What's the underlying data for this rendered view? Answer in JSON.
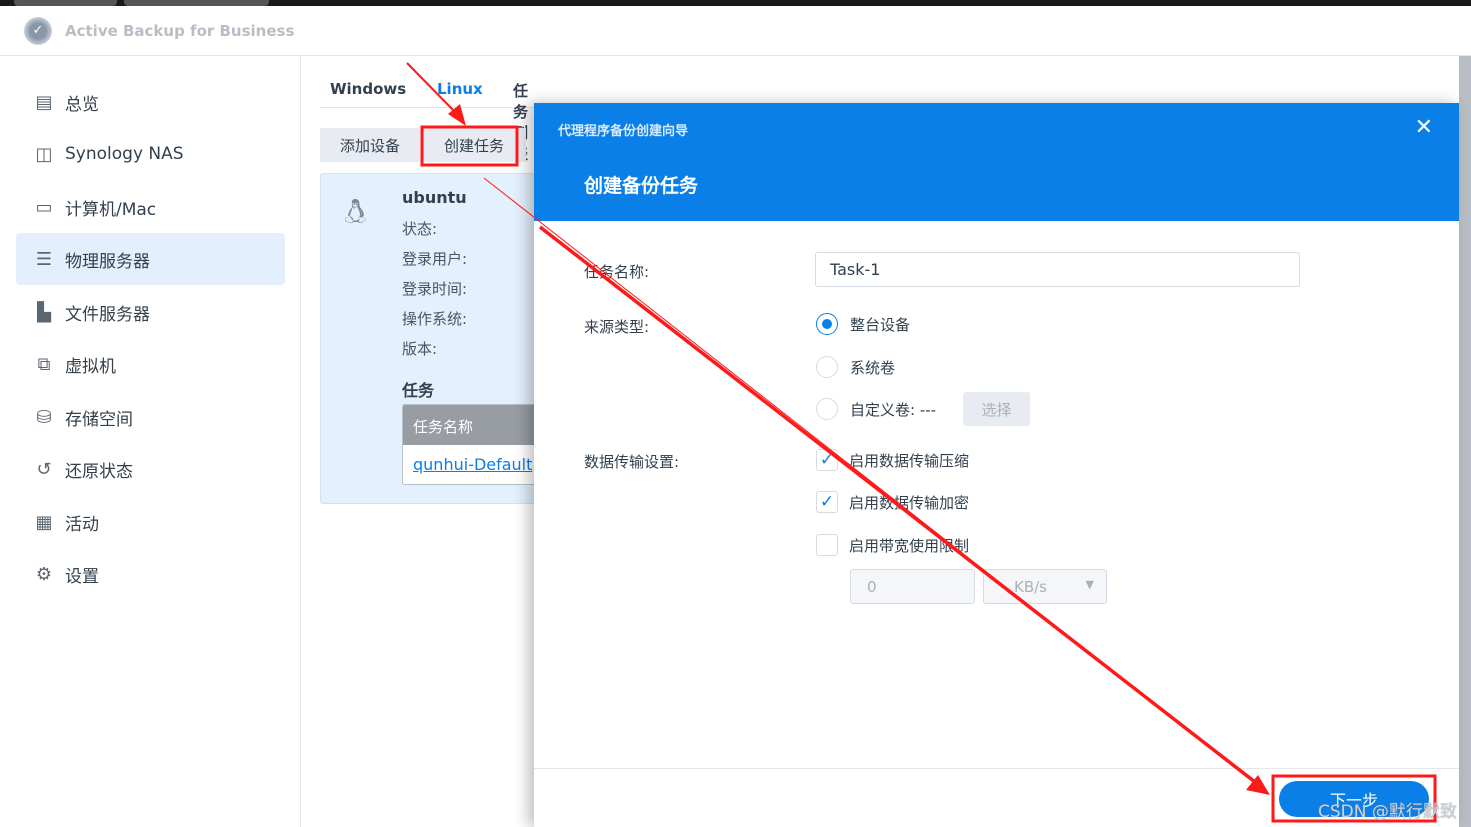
{
  "app": {
    "title": "Active Backup for Business"
  },
  "sidebar": {
    "items": [
      {
        "label": "总览",
        "icon": "overview-icon"
      },
      {
        "label": "Synology NAS",
        "icon": "nas-icon"
      },
      {
        "label": "计算机/Mac",
        "icon": "computer-icon"
      },
      {
        "label": "物理服务器",
        "icon": "server-icon",
        "active": true
      },
      {
        "label": "文件服务器",
        "icon": "file-server-icon"
      },
      {
        "label": "虚拟机",
        "icon": "vm-icon"
      },
      {
        "label": "存储空间",
        "icon": "storage-icon"
      },
      {
        "label": "还原状态",
        "icon": "restore-icon"
      },
      {
        "label": "活动",
        "icon": "activity-icon"
      },
      {
        "label": "设置",
        "icon": "gear-icon"
      }
    ]
  },
  "main": {
    "tabs": [
      {
        "label": "Windows"
      },
      {
        "label": "Linux",
        "active": true
      },
      {
        "label": "任务列表"
      }
    ],
    "toolbar": {
      "add_device": "添加设备",
      "create_task": "创建任务"
    },
    "device": {
      "name": "ubuntu",
      "fields": [
        "状态:",
        "登录用户:",
        "登录时间:",
        "操作系统:",
        "版本:"
      ],
      "tasks_heading": "任务",
      "tasks_col": "任务名称",
      "tasks": [
        "qunhui-Default"
      ]
    }
  },
  "dialog": {
    "subtitle": "代理程序备份创建向导",
    "title": "创建备份任务",
    "task_name_label": "任务名称:",
    "task_name_value": "Task-1",
    "source_type_label": "来源类型:",
    "source_options": [
      {
        "label": "整台设备",
        "selected": true
      },
      {
        "label": "系统卷",
        "selected": false
      },
      {
        "label": "自定义卷: ---",
        "selected": false
      }
    ],
    "select_button": "选择",
    "transfer_label": "数据传输设置:",
    "transfer_options": [
      {
        "label": "启用数据传输压缩",
        "checked": true
      },
      {
        "label": "启用数据传输加密",
        "checked": true
      },
      {
        "label": "启用带宽使用限制",
        "checked": false
      }
    ],
    "bandwidth_value": "0",
    "bandwidth_unit": "KB/s",
    "next_button": "下一步"
  },
  "colors": {
    "accent": "#0a7fe8",
    "annotation": "#ff1a1a"
  },
  "watermark": "CSDN @默行默致"
}
